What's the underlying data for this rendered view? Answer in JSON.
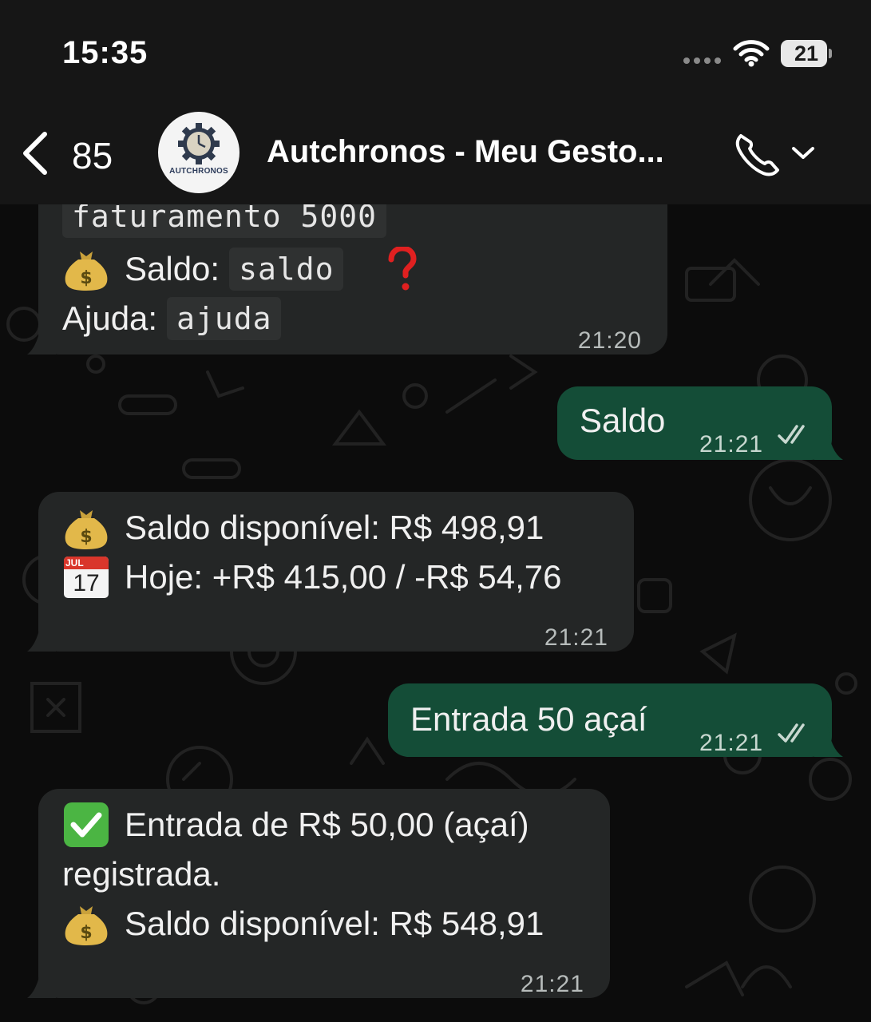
{
  "status_bar": {
    "time": "15:35",
    "battery_level": "21"
  },
  "header": {
    "back_count": "85",
    "avatar_label": "AUTCHRONOS",
    "title": "Autchronos - Meu Gesto..."
  },
  "messages": [
    {
      "direction": "incoming",
      "lines": [
        {
          "code": "faturamento 5000"
        },
        {
          "emoji": "money-bag-icon",
          "text": "Saldo:",
          "code": "saldo",
          "extra_emoji": "red-question-mark-icon"
        },
        {
          "text": "Ajuda:",
          "code": "ajuda"
        }
      ],
      "time": "21:20"
    },
    {
      "direction": "outgoing",
      "text": "Saldo",
      "time": "21:21",
      "status": "read"
    },
    {
      "direction": "incoming",
      "lines": [
        {
          "emoji": "money-bag-icon",
          "text": "Saldo disponível: R$ 498,91"
        },
        {
          "emoji": "calendar-icon",
          "emoji_label_month": "JUL",
          "emoji_label_day": "17",
          "text": "Hoje: +R$ 415,00 / -R$ 54,76"
        }
      ],
      "time": "21:21"
    },
    {
      "direction": "outgoing",
      "text": "Entrada 50 açaí",
      "time": "21:21",
      "status": "read"
    },
    {
      "direction": "incoming",
      "lines": [
        {
          "emoji": "check-mark-button-icon",
          "text": "Entrada de R$ 50,00 (açaí)"
        },
        {
          "text": "registrada."
        },
        {
          "emoji": "money-bag-icon",
          "text": "Saldo disponível: R$ 548,91"
        }
      ],
      "time": "21:21"
    }
  ],
  "colors": {
    "background": "#0b0b0b",
    "header": "#161616",
    "incoming_bubble": "#242626",
    "outgoing_bubble": "#144d37",
    "read_ticks": "#c8d8d0"
  }
}
